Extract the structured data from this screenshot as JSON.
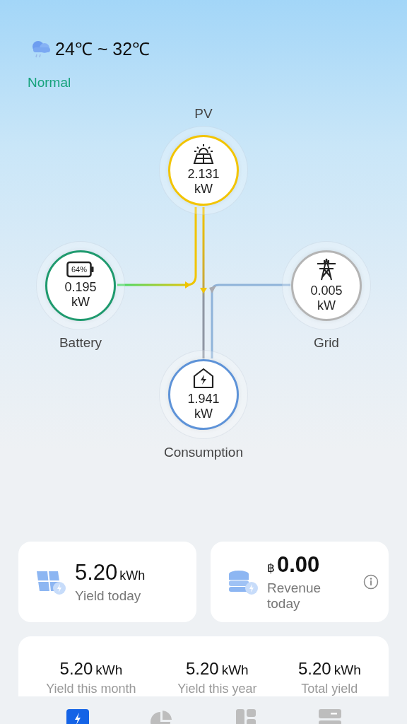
{
  "weather": {
    "temperature": "24℃ ~ 32℃"
  },
  "status": "Normal",
  "flow": {
    "nodes": [
      {
        "kind": "pv",
        "label": "PV",
        "value": "2.131",
        "unit": "kW",
        "color": "#f2c400"
      },
      {
        "kind": "battery",
        "label": "Battery",
        "value": "0.195",
        "unit": "kW",
        "charge": "64%",
        "color": "#1f9a6e"
      },
      {
        "kind": "grid",
        "label": "Grid",
        "value": "0.005",
        "unit": "kW",
        "color": "#b4b4b4"
      },
      {
        "kind": "consumption",
        "label": "Consumption",
        "value": "1.941",
        "unit": "kW",
        "color": "#5e93d8"
      }
    ]
  },
  "summary_cards": [
    {
      "kind": "yield",
      "value": "5.20",
      "unit": "kWh",
      "label": "Yield today"
    },
    {
      "kind": "revenue",
      "currency": "฿",
      "value": "0.00",
      "label": "Revenue today"
    }
  ],
  "yield_stats": [
    {
      "value": "5.20",
      "unit": "kWh",
      "label": "Yield this month"
    },
    {
      "value": "5.20",
      "unit": "kWh",
      "label": "Yield this year"
    },
    {
      "value": "5.20",
      "unit": "kWh",
      "label": "Total yield"
    }
  ],
  "bottom_nav": [
    {
      "kind": "flow",
      "selected": true
    },
    {
      "kind": "chart",
      "selected": false
    },
    {
      "kind": "dashboard",
      "selected": false
    },
    {
      "kind": "devices",
      "selected": false
    }
  ]
}
